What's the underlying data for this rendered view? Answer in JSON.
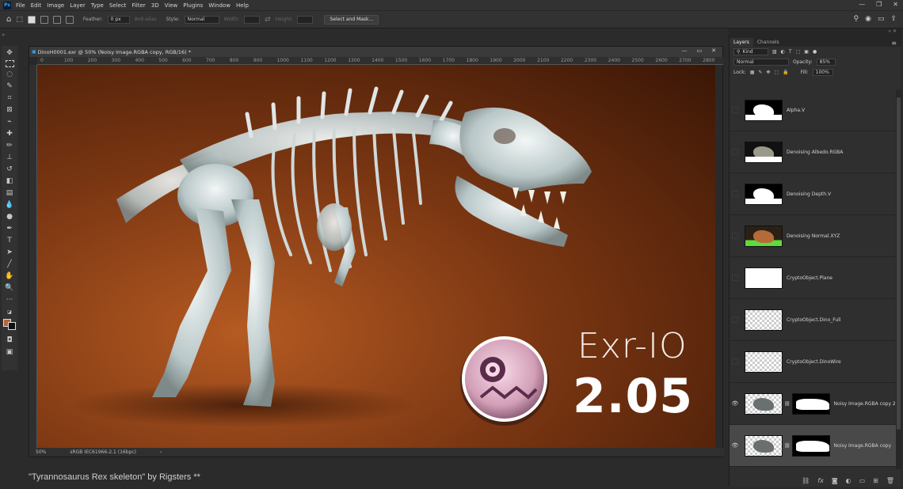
{
  "app": {
    "logo": "Ps"
  },
  "menu": [
    "File",
    "Edit",
    "Image",
    "Layer",
    "Type",
    "Select",
    "Filter",
    "3D",
    "View",
    "Plugins",
    "Window",
    "Help"
  ],
  "window_controls": [
    "—",
    "❐",
    "✕"
  ],
  "options": {
    "feather_label": "Feather:",
    "feather_value": "0 px",
    "antialias_label": "Anti-alias",
    "style_label": "Style:",
    "style_value": "Normal",
    "width_label": "Width:",
    "height_label": "Height:",
    "select_mask_label": "Select and Mask..."
  },
  "document": {
    "title": "DinoH0001.exr @ 50% (Noisy Image.RGBA copy, RGB/16) *",
    "ruler_ticks": [
      "0",
      "100",
      "200",
      "300",
      "400",
      "500",
      "600",
      "700",
      "800",
      "900",
      "1000",
      "1100",
      "1200",
      "1300",
      "1400",
      "1500",
      "1600",
      "1700",
      "1800",
      "1900",
      "2000",
      "2100",
      "2200",
      "2300",
      "2400",
      "2500",
      "2600",
      "2700",
      "2800"
    ],
    "zoom": "50%",
    "color_profile": "sRGB IEC61966-2.1 (16bpc)",
    "status_arrow": "›"
  },
  "artwork": {
    "product_name": "Exr-IO",
    "product_version": "2.05"
  },
  "caption": "\"Tyrannosaurus Rex skeleton\" by Rigsters **",
  "panel": {
    "tabs": [
      "Layers",
      "Channels"
    ],
    "filter_kind": "Kind",
    "blend_mode": "Normal",
    "opacity_label": "Opacity:",
    "opacity_value": "85%",
    "lock_label": "Lock:",
    "fill_label": "Fill:",
    "fill_value": "100%",
    "layers": [
      {
        "name": "Alpha.V",
        "visible": false,
        "thumb": "alpha"
      },
      {
        "name": "Denoising Albedo.RGBA",
        "visible": false,
        "thumb": "albedo"
      },
      {
        "name": "Denoising Depth.V",
        "visible": false,
        "thumb": "depth"
      },
      {
        "name": "Denoising Normal.XYZ",
        "visible": false,
        "thumb": "normal"
      },
      {
        "name": "CryptoObject.Plane",
        "visible": false,
        "thumb": "plane"
      },
      {
        "name": "CryptoObject.Dino_Full",
        "visible": false,
        "thumb": "checker"
      },
      {
        "name": "CryptoObject.DinoWire",
        "visible": false,
        "thumb": "checker"
      },
      {
        "name": "Noisy Image.RGBA copy 2",
        "visible": true,
        "thumb": "noisy",
        "mask": true
      },
      {
        "name": "Noisy Image.RGBA copy",
        "visible": true,
        "thumb": "noisy",
        "mask": true,
        "selected": true
      }
    ]
  },
  "colors": {
    "canvas_center": "#b55a22",
    "canvas_edge": "#3a1606",
    "accent": "#31a8ff"
  }
}
